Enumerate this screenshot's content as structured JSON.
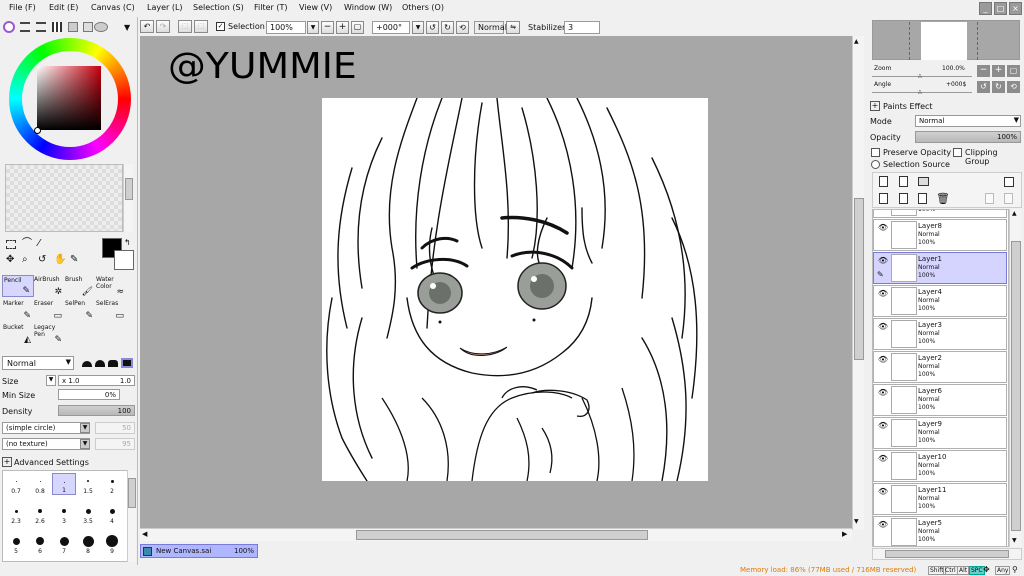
{
  "menu": {
    "items": [
      "File (F)",
      "Edit (E)",
      "Canvas (C)",
      "Layer (L)",
      "Selection (S)",
      "Filter (T)",
      "View (V)",
      "Window (W)",
      "Others (O)"
    ]
  },
  "toolbar": {
    "selection_label": "Selection",
    "zoom_value": "100%",
    "angle_value": "+000°",
    "blend_mode": "Normal",
    "stabilizer_label": "Stabilizer",
    "stabilizer_value": "3"
  },
  "canvas": {
    "watermark": "@YUMMIE",
    "tab_name": "New Canvas.sai",
    "tab_zoom": "100%"
  },
  "tools": {
    "items": [
      {
        "label": "Pencil",
        "icon": "pencil-icon"
      },
      {
        "label": "AirBrush",
        "icon": "airbrush-icon"
      },
      {
        "label": "Brush",
        "icon": "brush-icon"
      },
      {
        "label": "Water Color",
        "icon": "watercolor-icon"
      },
      {
        "label": "Marker",
        "icon": "marker-icon"
      },
      {
        "label": "Eraser",
        "icon": "eraser-icon"
      },
      {
        "label": "SelPen",
        "icon": "selpen-icon"
      },
      {
        "label": "SelEras",
        "icon": "seleras-icon"
      },
      {
        "label": "Bucket",
        "icon": "bucket-icon"
      },
      {
        "label": "Legacy Pen",
        "icon": "legacy-pen-icon"
      }
    ],
    "selected": "Pencil"
  },
  "brush": {
    "blend_mode": "Normal",
    "size_label": "Size",
    "size_multiplier": "x 1.0",
    "size_value": "1.0",
    "min_size_label": "Min Size",
    "min_size_value": "0%",
    "density_label": "Density",
    "density_value": "100",
    "shape": "(simple circle)",
    "shape_value": "50",
    "texture": "(no texture)",
    "texture_value": "95",
    "advanced_label": "Advanced Settings",
    "sizes": [
      "0.7",
      "0.8",
      "1",
      "1.5",
      "2",
      "2.3",
      "2.6",
      "3",
      "3.5",
      "4",
      "5",
      "6",
      "7",
      "8",
      "9"
    ],
    "selected_size": "1"
  },
  "colors": {
    "primary": "#000000",
    "secondary": "#ffffff",
    "hue_square": "#c8000f"
  },
  "navigator": {
    "zoom_label": "Zoom",
    "zoom_value": "100.0%",
    "angle_label": "Angle",
    "angle_value": "+000$"
  },
  "layer_props": {
    "paint_effect_label": "Paints Effect",
    "mode_label": "Mode",
    "mode_value": "Normal",
    "opacity_label": "Opacity",
    "opacity_value": "100%",
    "preserve_opacity": "Preserve Opacity",
    "clipping_group": "Clipping Group",
    "selection_source": "Selection Source"
  },
  "layers": [
    {
      "name": "",
      "mode": "",
      "opacity": "100%",
      "partial": true
    },
    {
      "name": "Layer8",
      "mode": "Normal",
      "opacity": "100%"
    },
    {
      "name": "Layer1",
      "mode": "Normal",
      "opacity": "100%",
      "selected": true
    },
    {
      "name": "Layer4",
      "mode": "Normal",
      "opacity": "100%"
    },
    {
      "name": "Layer3",
      "mode": "Normal",
      "opacity": "100%"
    },
    {
      "name": "Layer2",
      "mode": "Normal",
      "opacity": "100%"
    },
    {
      "name": "Layer6",
      "mode": "Normal",
      "opacity": "100%"
    },
    {
      "name": "Layer9",
      "mode": "Normal",
      "opacity": "100%"
    },
    {
      "name": "Layer10",
      "mode": "Normal",
      "opacity": "100%"
    },
    {
      "name": "Layer11",
      "mode": "Normal",
      "opacity": "100%"
    },
    {
      "name": "Layer5",
      "mode": "Normal",
      "opacity": "100%"
    }
  ],
  "status": {
    "memory": "Memory load: 86% (77MB used / 716MB reserved)",
    "keys": [
      "Shift",
      "Ctrl",
      "Alt",
      "SPC",
      "Any"
    ]
  }
}
